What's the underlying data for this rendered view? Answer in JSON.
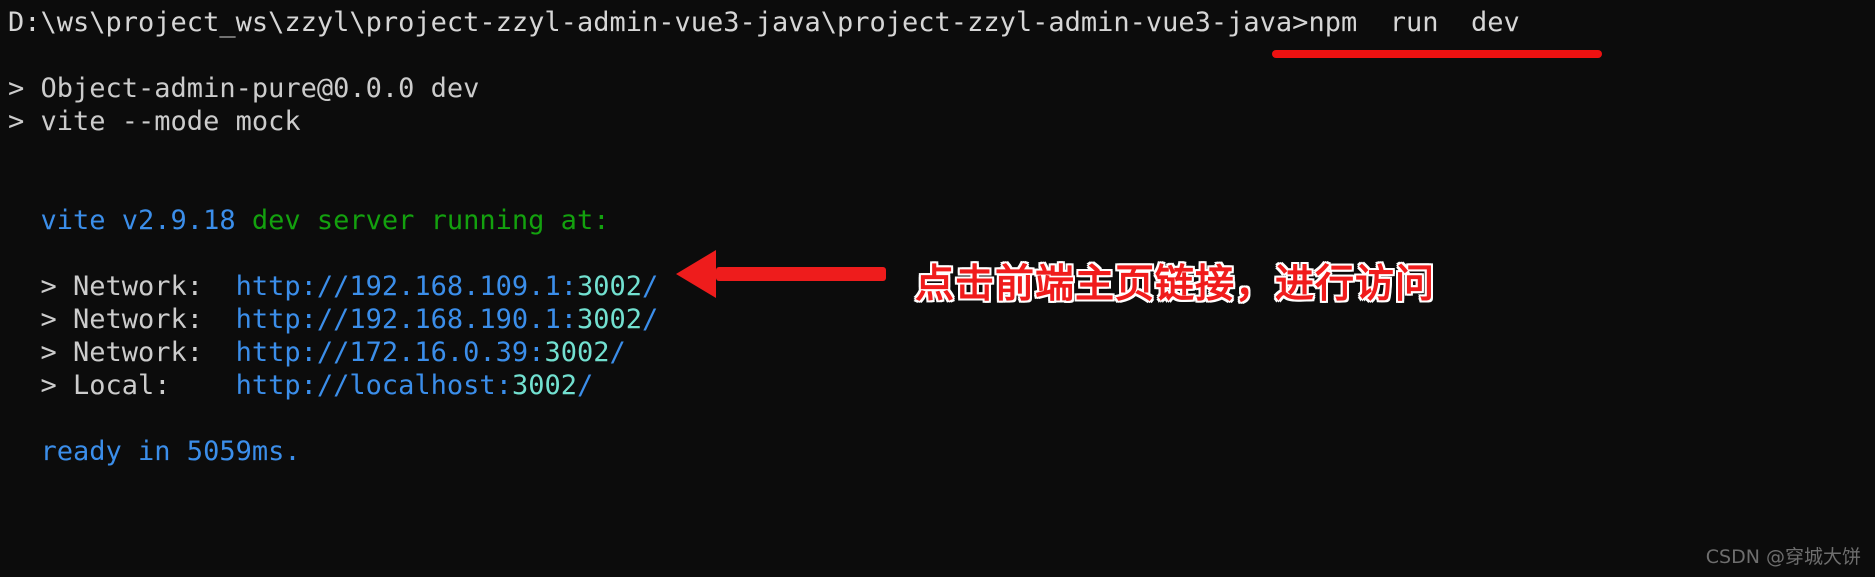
{
  "terminal": {
    "prompt": {
      "path": "D:\\ws\\project_ws\\zzyl\\project-zzyl-admin-vue3-java\\project-zzyl-admin-vue3-java>",
      "command": "npm  run  dev"
    },
    "lines": {
      "script_name": "> Object-admin-pure@0.0.0 dev",
      "script_cmd": "> vite --mode mock",
      "vite_version": "  vite v2.9.18",
      "vite_status": " dev server running at:",
      "ready": "  ready in 5059ms."
    },
    "servers": [
      {
        "label": "  > Network:  ",
        "scheme": "http://",
        "host": "192.168.109.1",
        "colon": ":",
        "port": "3002",
        "slash": "/"
      },
      {
        "label": "  > Network:  ",
        "scheme": "http://",
        "host": "192.168.190.1",
        "colon": ":",
        "port": "3002",
        "slash": "/"
      },
      {
        "label": "  > Network:  ",
        "scheme": "http://",
        "host": "172.16.0.39",
        "colon": ":",
        "port": "3002",
        "slash": "/"
      },
      {
        "label": "  > Local:    ",
        "scheme": "http://",
        "host": "localhost",
        "colon": ":",
        "port": "3002",
        "slash": "/"
      }
    ]
  },
  "annotations": {
    "note_text": "点击前端主页链接，进行访问",
    "note_color": "#f01c1c",
    "underline_color": "#ee1111",
    "arrow_color": "#ee1c1c"
  },
  "watermark": {
    "text": "CSDN @穿城大饼"
  }
}
